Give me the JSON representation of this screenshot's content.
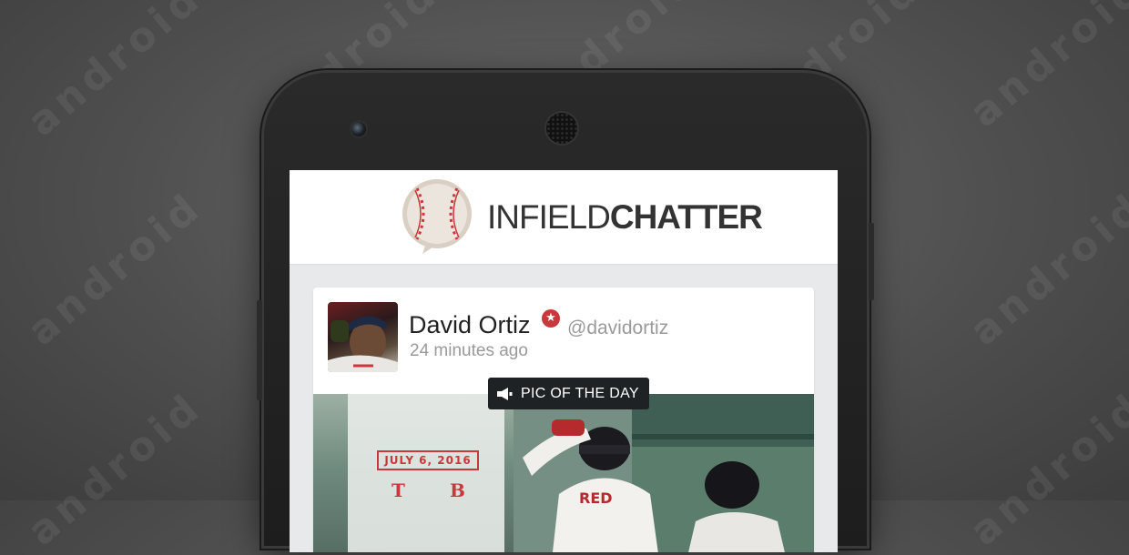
{
  "watermark": "android",
  "app": {
    "logo_light": "INFIELD",
    "logo_bold": "CHATTER"
  },
  "post": {
    "author_name": "David Ortiz",
    "handle": "@davidortiz",
    "time_ago": "24 minutes ago",
    "badge_label": "PIC OF THE DAY",
    "badge_icon": "megaphone-icon",
    "verified_icon": "star-badge-icon"
  },
  "photo": {
    "date": "JULY 6, 2016",
    "team_away": "T",
    "team_home": "B"
  },
  "colors": {
    "accent_red": "#c8393b",
    "badge_bg": "#1f2224"
  }
}
